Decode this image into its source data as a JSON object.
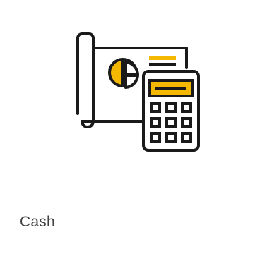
{
  "card": {
    "title": "Cash",
    "icon": "finance-calculator-icon"
  },
  "colors": {
    "accent": "#F5B800",
    "stroke": "#1a1a1a",
    "border": "#d9d9d9",
    "text": "#3f3f3f"
  }
}
